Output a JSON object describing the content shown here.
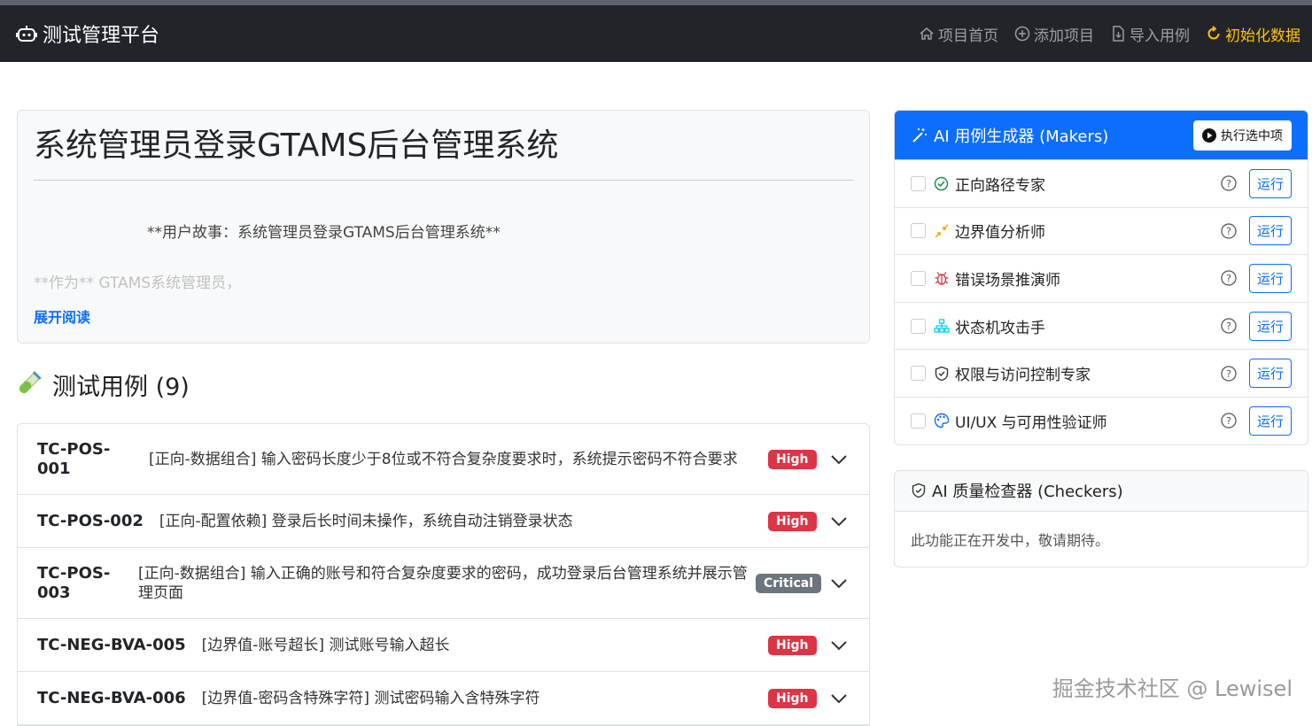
{
  "navbar": {
    "brand": "测试管理平台",
    "links": [
      {
        "label": "项目首页",
        "icon": "home-icon"
      },
      {
        "label": "添加项目",
        "icon": "plus-circle-icon"
      },
      {
        "label": "导入用例",
        "icon": "file-import-icon"
      },
      {
        "label": "初始化数据",
        "icon": "refresh-icon"
      }
    ]
  },
  "story": {
    "title": "系统管理员登录GTAMS后台管理系统",
    "line1": "**用户故事：系统管理员登录GTAMS后台管理系统**",
    "line2": "**作为** GTAMS系统管理员，",
    "expand": "展开阅读"
  },
  "cases": {
    "heading": "测试用例 (9)",
    "items": [
      {
        "id": "TC-POS-001",
        "title": "[正向-数据组合] 输入密码长度少于8位或不符合复杂度要求时，系统提示密码不符合要求",
        "priority": "High"
      },
      {
        "id": "TC-POS-002",
        "title": "[正向-配置依赖] 登录后长时间未操作，系统自动注销登录状态",
        "priority": "High"
      },
      {
        "id": "TC-POS-003",
        "title": "[正向-数据组合] 输入正确的账号和符合复杂度要求的密码，成功登录后台管理系统并展示管理页面",
        "priority": "Critical"
      },
      {
        "id": "TC-NEG-BVA-005",
        "title": "[边界值-账号超长] 测试账号输入超长",
        "priority": "High"
      },
      {
        "id": "TC-NEG-BVA-006",
        "title": "[边界值-密码含特殊字符] 测试密码输入含特殊字符",
        "priority": "High"
      }
    ]
  },
  "makers": {
    "title": "AI 用例生成器 (Makers)",
    "run_selected": "执行选中项",
    "run_label": "运行",
    "items": [
      {
        "label": "正向路径专家",
        "icon": "check-circle-icon"
      },
      {
        "label": "边界值分析师",
        "icon": "arrows-in-icon"
      },
      {
        "label": "错误场景推演师",
        "icon": "bug-icon"
      },
      {
        "label": "状态机攻击手",
        "icon": "diagram-icon"
      },
      {
        "label": "权限与访问控制专家",
        "icon": "shield-icon"
      },
      {
        "label": "UI/UX 与可用性验证师",
        "icon": "palette-icon"
      }
    ]
  },
  "checkers": {
    "title": "AI 质量检查器 (Checkers)",
    "body": "此功能正在开发中，敬请期待。"
  },
  "watermark": "掘金技术社区 @ Lewisel"
}
